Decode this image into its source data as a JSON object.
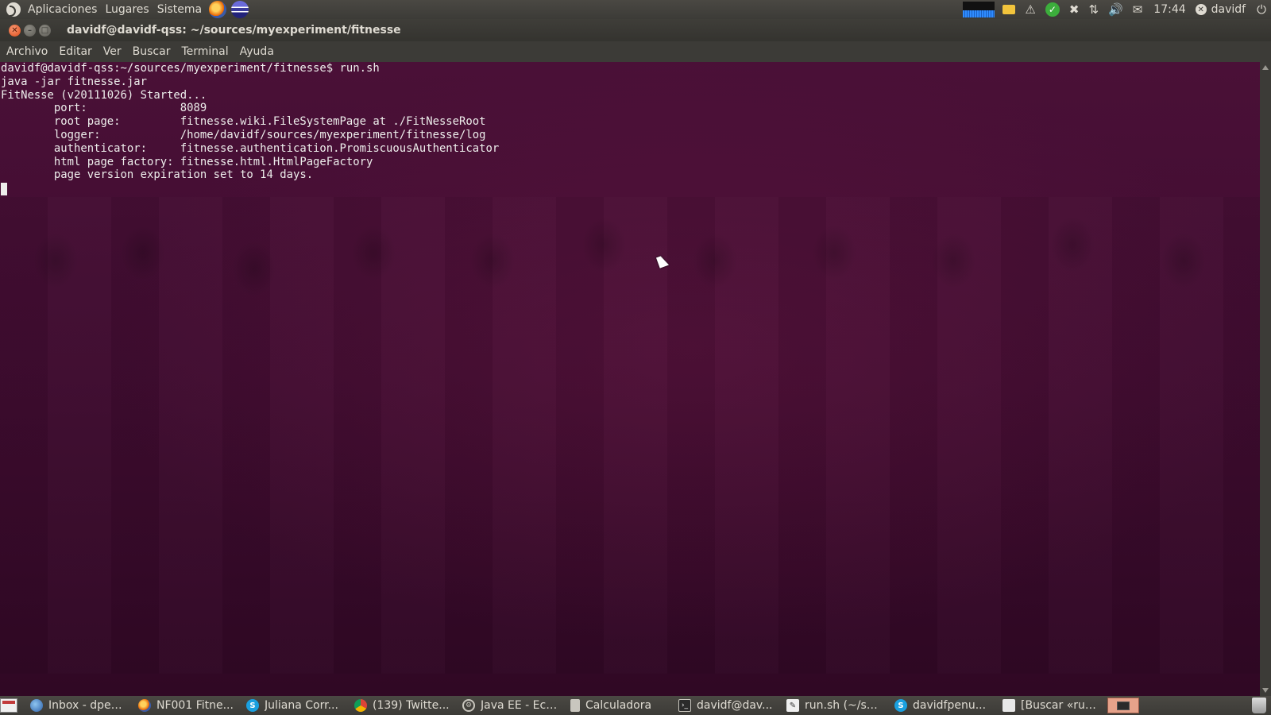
{
  "top_panel": {
    "menus": [
      "Aplicaciones",
      "Lugares",
      "Sistema"
    ],
    "clock": "17:44",
    "user": "davidf"
  },
  "window": {
    "title": "davidf@davidf-qss: ~/sources/myexperiment/fitnesse",
    "menu": [
      "Archivo",
      "Editar",
      "Ver",
      "Buscar",
      "Terminal",
      "Ayuda"
    ]
  },
  "terminal": {
    "lines": [
      "davidf@davidf-qss:~/sources/myexperiment/fitnesse$ run.sh",
      "java -jar fitnesse.jar",
      "FitNesse (v20111026) Started...",
      "        port:              8089",
      "        root page:         fitnesse.wiki.FileSystemPage at ./FitNesseRoot",
      "        logger:            /home/davidf/sources/myexperiment/fitnesse/log",
      "        authenticator:     fitnesse.authentication.PromiscuousAuthenticator",
      "        html page factory: fitnesse.html.HtmlPageFactory",
      "        page version expiration set to 14 days."
    ]
  },
  "taskbar": {
    "tasks": [
      {
        "label": "Inbox - dpen...",
        "icon": "thunderbird-icon"
      },
      {
        "label": "NF001 Fitne...",
        "icon": "firefox-icon"
      },
      {
        "label": "Juliana Corr...",
        "icon": "skype-icon"
      },
      {
        "label": "(139) Twitte...",
        "icon": "chrome-icon"
      },
      {
        "label": "Java EE - Ecli...",
        "icon": "eclipse-icon"
      },
      {
        "label": "Calculadora",
        "icon": "calculator-icon"
      },
      {
        "label": "davidf@dav...",
        "icon": "terminal-icon"
      },
      {
        "label": "run.sh (~/so...",
        "icon": "text-editor-icon"
      },
      {
        "label": "davidfpenu...",
        "icon": "skype-icon"
      },
      {
        "label": "[Buscar «run...",
        "icon": "document-icon"
      }
    ]
  },
  "colors": {
    "terminal_bg": "#3f0c30",
    "panel_bg": "#3c3b37",
    "text": "#eeeeec"
  }
}
